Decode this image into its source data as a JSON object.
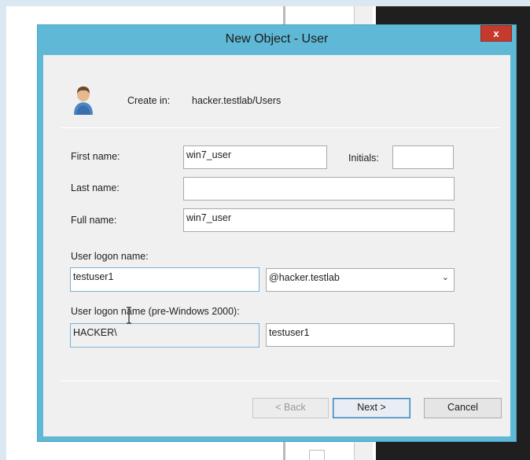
{
  "dialog": {
    "title": "New Object - User",
    "close_label": "x",
    "create_in_label": "Create in:",
    "create_in_path": "hacker.testlab/Users"
  },
  "form": {
    "first_name_label": "First name:",
    "first_name_value": "win7_user",
    "initials_label": "Initials:",
    "initials_value": "",
    "last_name_label": "Last name:",
    "last_name_value": "",
    "full_name_label": "Full name:",
    "full_name_value": "win7_user",
    "logon_name_label": "User logon name:",
    "logon_name_value": "testuser1",
    "logon_domain_selected": "@hacker.testlab",
    "pre2000_label": "User logon name (pre-Windows 2000):",
    "pre2000_domain_value": "HACKER\\",
    "pre2000_name_value": "testuser1"
  },
  "buttons": {
    "back": "< Back",
    "next": "Next >",
    "cancel": "Cancel"
  },
  "icons": {
    "user": "user-icon",
    "close": "close-icon",
    "dropdown": "chevron-down-icon",
    "cursor": "text-cursor-icon"
  },
  "colors": {
    "title_bar": "#5fb8d5",
    "close_button": "#c53a2c",
    "client_bg": "#f0f0f0",
    "focus_border": "#7ab1d6"
  }
}
